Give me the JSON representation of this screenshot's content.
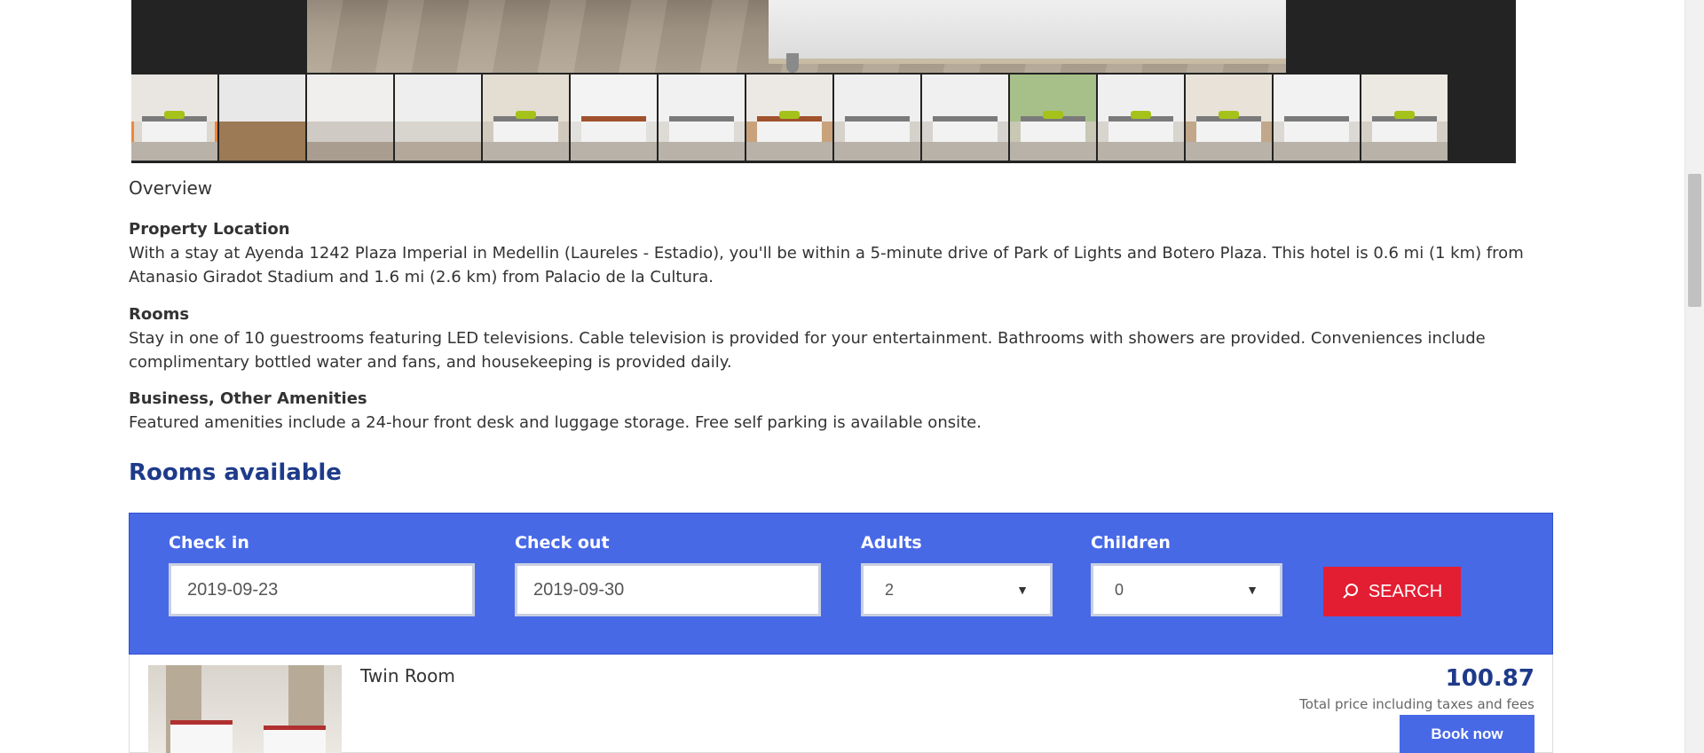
{
  "gallery": {
    "thumbnail_count": 15,
    "active_index": 0
  },
  "overview": {
    "title": "Overview"
  },
  "description": {
    "location": {
      "heading": "Property Location",
      "text": "With a stay at Ayenda 1242 Plaza Imperial in Medellin (Laureles - Estadio), you'll be within a 5-minute drive of Park of Lights and Botero Plaza. This hotel is 0.6 mi (1 km) from Atanasio Giradot Stadium and 1.6 mi (2.6 km) from Palacio de la Cultura."
    },
    "rooms": {
      "heading": "Rooms",
      "text": "Stay in one of 10 guestrooms featuring LED televisions. Cable television is provided for your entertainment. Bathrooms with showers are provided. Conveniences include complimentary bottled water and fans, and housekeeping is provided daily."
    },
    "business": {
      "heading": "Business, Other Amenities",
      "text": "Featured amenities include a 24-hour front desk and luggage storage. Free self parking is available onsite."
    }
  },
  "rooms_available": {
    "title": "Rooms available"
  },
  "search": {
    "checkin_label": "Check in",
    "checkin_value": "2019-09-23",
    "checkout_label": "Check out",
    "checkout_value": "2019-09-30",
    "adults_label": "Adults",
    "adults_value": "2",
    "children_label": "Children",
    "children_value": "0",
    "search_button": "SEARCH"
  },
  "room": {
    "name": "Twin Room",
    "price": "100.87",
    "price_note": "Total price including taxes and fees",
    "book_button": "Book now"
  },
  "colors": {
    "panel_blue": "#4869e6",
    "heading_blue": "#1e3a8a",
    "search_red": "#e31e32",
    "active_thumb": "#f0863b"
  }
}
